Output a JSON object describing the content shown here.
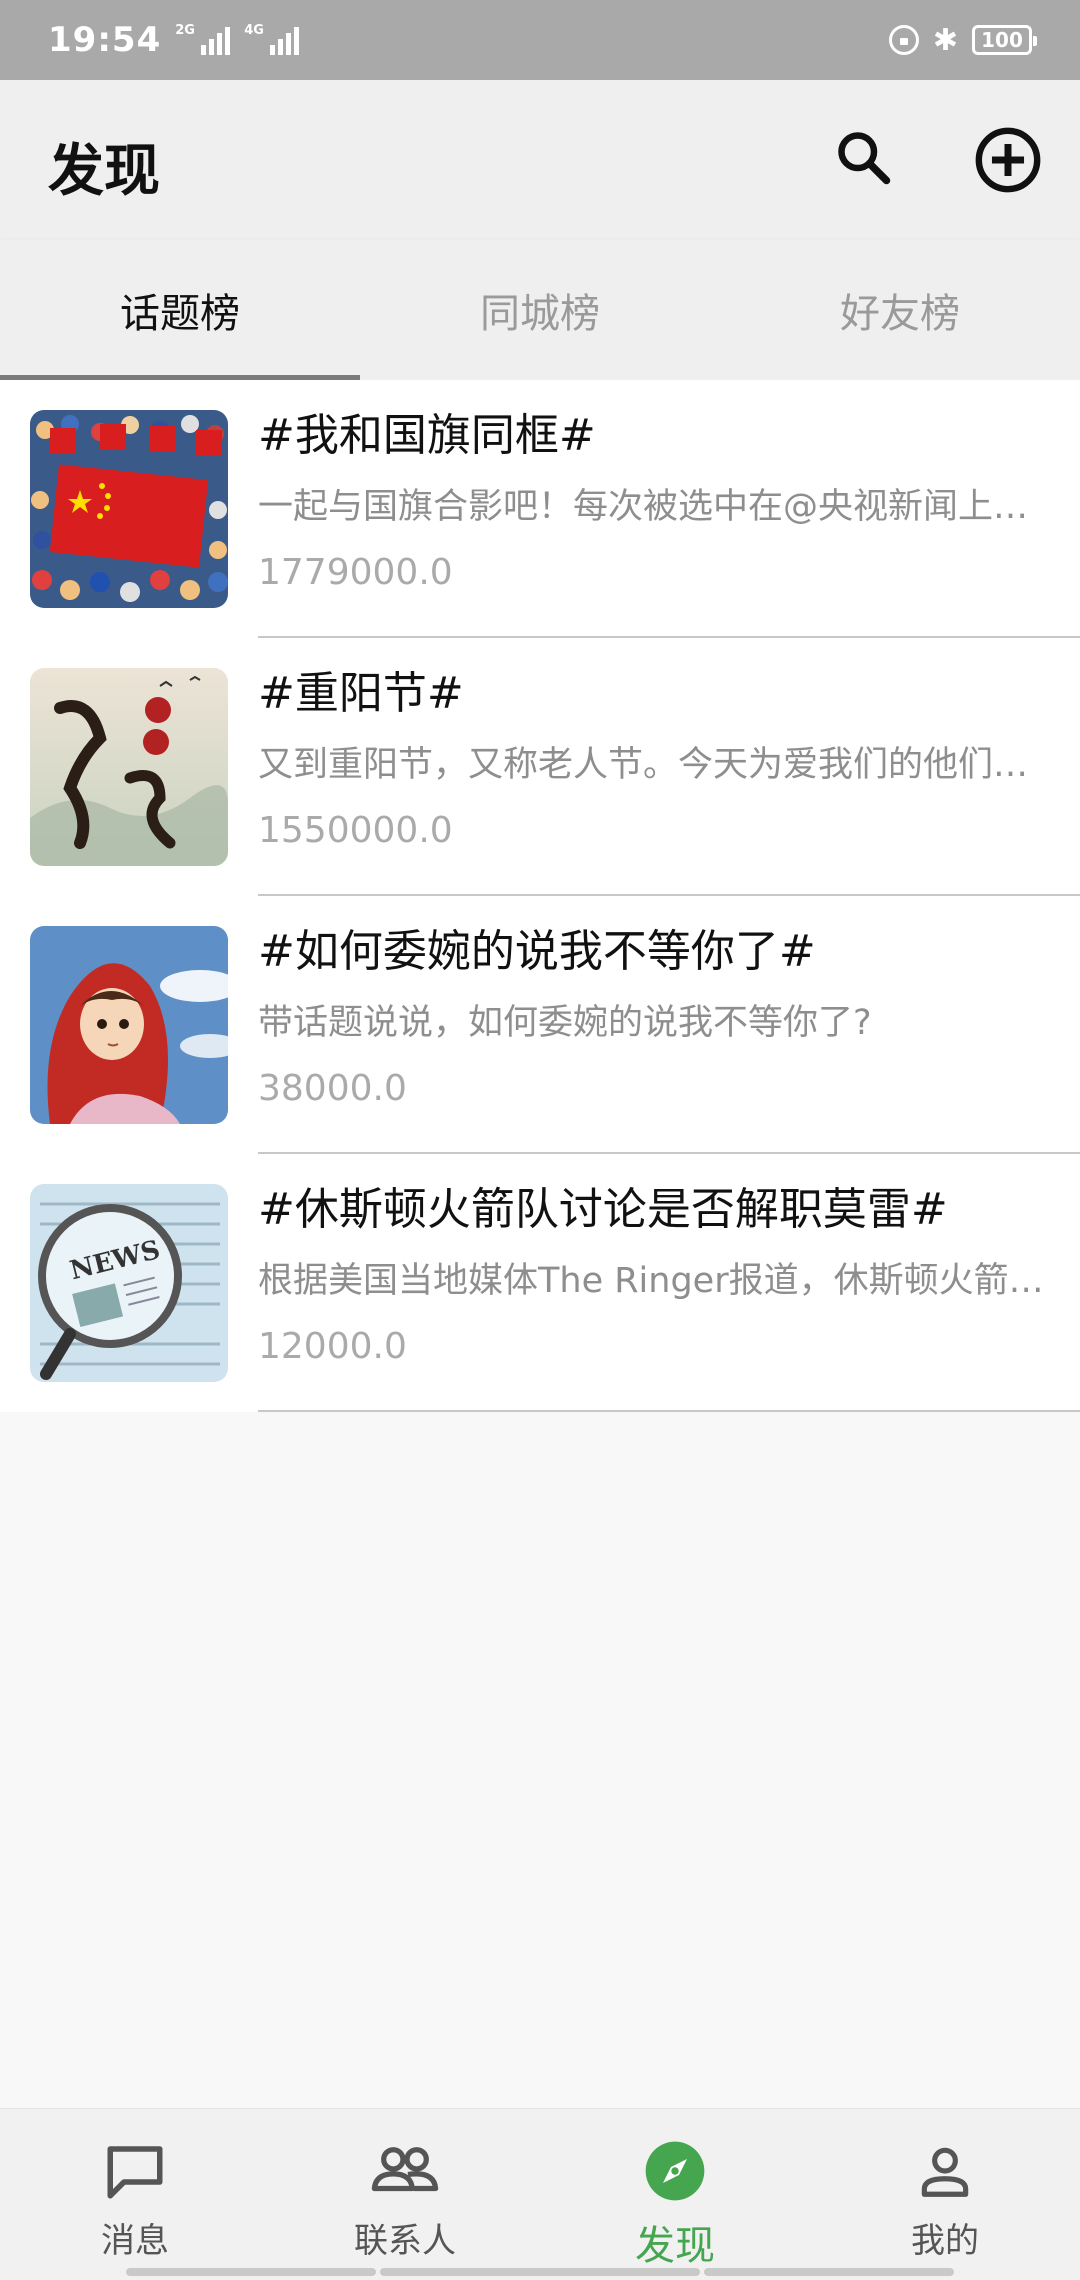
{
  "status_bar": {
    "time": "19:54",
    "sim1": "2G",
    "sim2": "4G",
    "battery": "100"
  },
  "header": {
    "title": "发现",
    "search_icon": "search-icon",
    "add_icon": "add-circle-icon"
  },
  "tabs": [
    {
      "label": "话题榜",
      "active": true
    },
    {
      "label": "同城榜",
      "active": false
    },
    {
      "label": "好友榜",
      "active": false
    }
  ],
  "topics": [
    {
      "title": "#我和国旗同框#",
      "desc": "一起与国旗合影吧！每次被选中在@央视新闻上进行展示",
      "count": "1779000.0",
      "thumb": "flag-crowd-image"
    },
    {
      "title": "#重阳节#",
      "desc": "又到重阳节，又称老人节。今天为爱我们的他们送上祝福",
      "count": "1550000.0",
      "thumb": "chongyang-calligraphy-image"
    },
    {
      "title": "#如何委婉的说我不等你了#",
      "desc": "带话题说说，如何委婉的说我不等你了?",
      "count": "38000.0",
      "thumb": "cartoon-girl-image"
    },
    {
      "title": "#休斯顿火箭队讨论是否解职莫雷#",
      "desc": "根据美国当地媒体The Ringer报道，休斯顿火箭队讨论",
      "count": "12000.0",
      "thumb": "newspaper-magnifier-image"
    }
  ],
  "bottom_nav": [
    {
      "label": "消息",
      "icon": "message-icon",
      "active": false
    },
    {
      "label": "联系人",
      "icon": "contacts-icon",
      "active": false
    },
    {
      "label": "发现",
      "icon": "compass-icon",
      "active": true
    },
    {
      "label": "我的",
      "icon": "person-icon",
      "active": false
    }
  ],
  "colors": {
    "accent": "#46a64f",
    "app_bar": "#efefef",
    "status_bar": "#a9a9a9"
  }
}
